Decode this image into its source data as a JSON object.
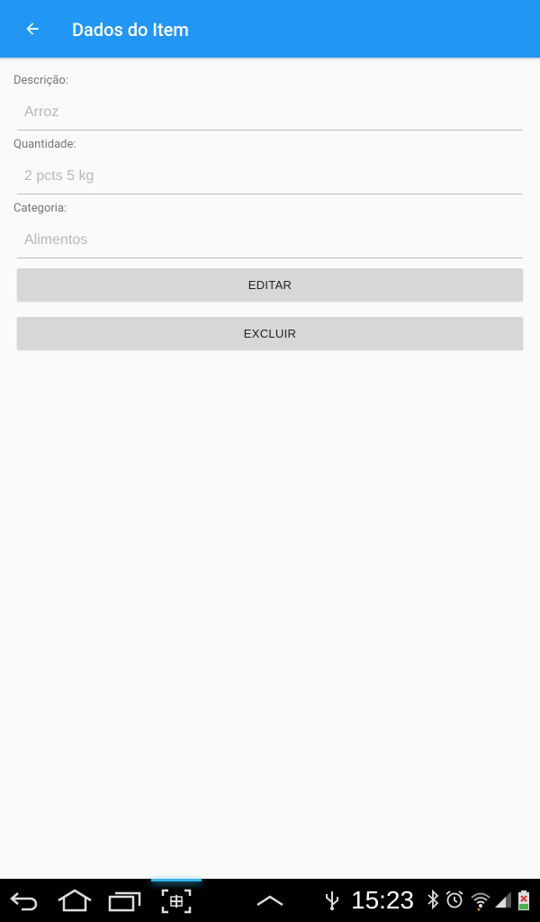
{
  "app_bar": {
    "title": "Dados do Item",
    "color": "#2196F3",
    "back_icon": "arrow-left-icon"
  },
  "form": {
    "description": {
      "label": "Descrição:",
      "placeholder": "Arroz"
    },
    "quantity": {
      "label": "Quantidade:",
      "placeholder": "2 pcts 5 kg"
    },
    "category": {
      "label": "Categoria:",
      "placeholder": "Alimentos"
    }
  },
  "buttons": {
    "edit_label": "EDITAR",
    "delete_label": "EXCLUIR"
  },
  "system_bar": {
    "time": "15:23",
    "nav_icons": [
      "back-icon",
      "home-icon",
      "recent-apps-icon",
      "screenshot-icon",
      "menu-up-icon"
    ],
    "status_icons": [
      "usb-icon",
      "bluetooth-icon",
      "alarm-icon",
      "wifi-icon",
      "signal-icon",
      "battery-icon"
    ]
  }
}
